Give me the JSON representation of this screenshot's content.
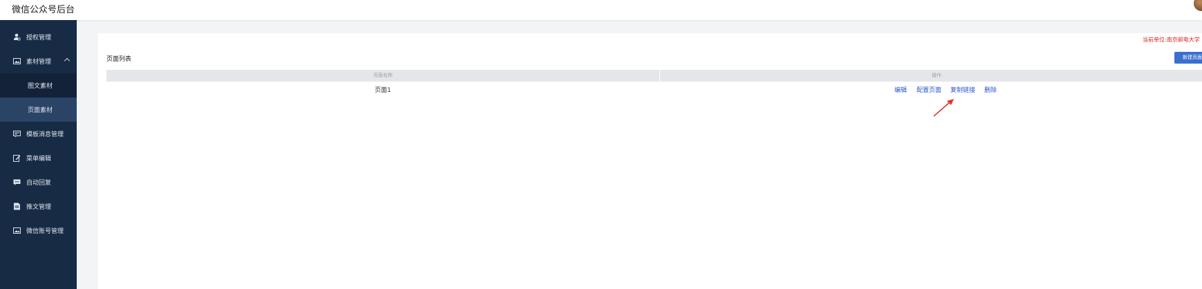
{
  "header": {
    "app_title": "微信公众号后台"
  },
  "sidebar": {
    "items": [
      {
        "label": "授权管理",
        "icon": "user-key-icon"
      },
      {
        "label": "素材管理",
        "icon": "image-icon",
        "expanded": true
      },
      {
        "label": "图文素材",
        "sub": true
      },
      {
        "label": "页面素材",
        "sub": true,
        "active": true
      },
      {
        "label": "模板消息管理",
        "icon": "template-icon"
      },
      {
        "label": "菜单编辑",
        "icon": "edit-icon"
      },
      {
        "label": "自动回复",
        "icon": "reply-icon"
      },
      {
        "label": "推文管理",
        "icon": "article-icon"
      },
      {
        "label": "微信账号管理",
        "icon": "account-icon"
      }
    ]
  },
  "main": {
    "current_unit": "当前单位:南京邮电大学",
    "list_title": "页面列表",
    "new_button": "新建页面",
    "table": {
      "columns": [
        "页面名称",
        "操作"
      ],
      "rows": [
        {
          "name": "页面1",
          "actions": [
            "编辑",
            "配置页面",
            "复制链接",
            "删除"
          ]
        }
      ]
    }
  },
  "colors": {
    "sidebar_bg": "#172b45",
    "accent": "#3a6fd0",
    "link": "#2d55c9",
    "unit_text": "#d9251d",
    "annotation_arrow": "#e8322b"
  }
}
